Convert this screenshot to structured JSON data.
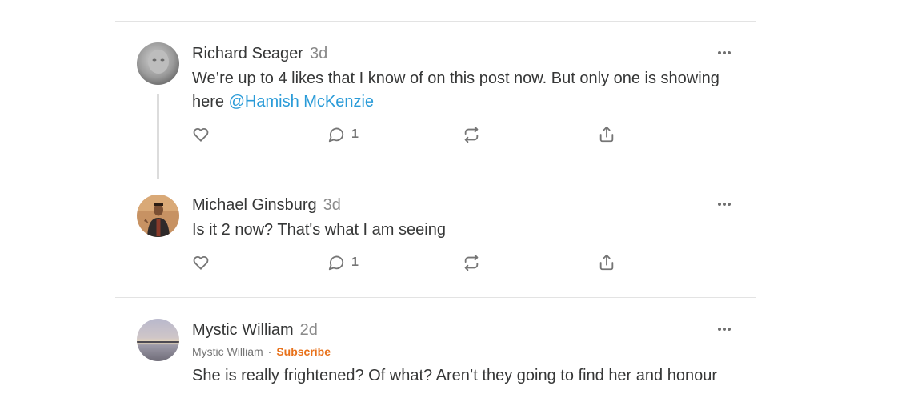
{
  "comments": [
    {
      "author": "Richard Seager",
      "time": "3d",
      "text_before_mention": "We’re up to 4 likes that I know of on this post now. But only one is showing here ",
      "mention": "@Hamish McKenzie",
      "reply_count": "1"
    },
    {
      "author": "Michael Ginsburg",
      "time": "3d",
      "text": "Is it 2 now? That's what I am seeing",
      "reply_count": "1"
    },
    {
      "author": "Mystic William",
      "time": "2d",
      "publication": "Mystic William",
      "separator": "·",
      "subscribe_label": "Subscribe",
      "text": "She is really frightened? Of what? Aren’t they going to find her and honour"
    }
  ],
  "icons": {
    "like": "heart-icon",
    "reply": "comment-bubble-icon",
    "restack": "restack-icon",
    "share": "share-icon",
    "more": "more-dots-icon"
  },
  "colors": {
    "mention": "#2a9bd8",
    "subscribe": "#e8711a",
    "text": "#363737",
    "muted": "#757575"
  }
}
